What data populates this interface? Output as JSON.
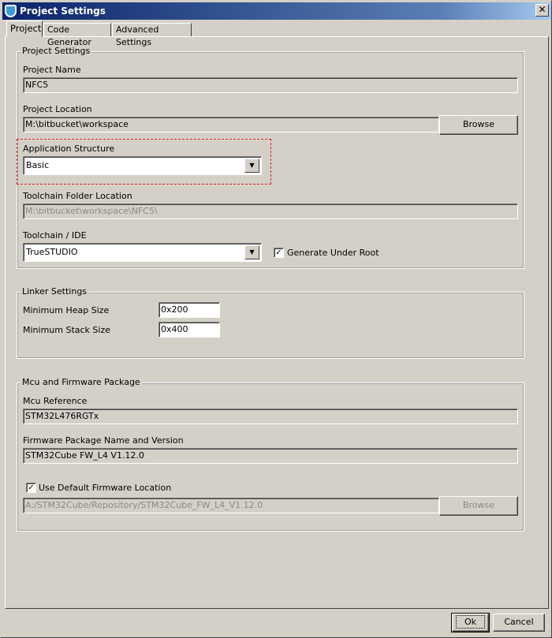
{
  "window": {
    "title": "Project Settings",
    "close": "✕"
  },
  "tabs": [
    {
      "label": "Project"
    },
    {
      "label": "Code Generator"
    },
    {
      "label": "Advanced Settings"
    }
  ],
  "project_settings": {
    "legend": "Project Settings",
    "name_label": "Project Name",
    "name_value": "NFC5",
    "location_label": "Project Location",
    "location_value": "M:\\bitbucket\\workspace",
    "browse": "Browse",
    "structure_label": "Application Structure",
    "structure_value": "Basic",
    "toolchain_folder_label": "Toolchain Folder Location",
    "toolchain_folder_value": "M:\\bitbucket\\workspace\\NFC5\\",
    "toolchain_label": "Toolchain / IDE",
    "toolchain_value": "TrueSTUDIO",
    "generate_under_root": "Generate Under Root",
    "generate_under_root_checked": true
  },
  "linker": {
    "legend": "Linker Settings",
    "heap_label": "Minimum Heap Size",
    "heap_value": "0x200",
    "stack_label": "Minimum Stack Size",
    "stack_value": "0x400"
  },
  "mcu": {
    "legend": "Mcu and Firmware Package",
    "ref_label": "Mcu Reference",
    "ref_value": "STM32L476RGTx",
    "fw_label": "Firmware Package Name and Version",
    "fw_value": "STM32Cube FW_L4 V1.12.0",
    "use_default": "Use Default Firmware Location",
    "use_default_checked": true,
    "fw_location": "A:/STM32Cube/Repository/STM32Cube_FW_L4_V1.12.0",
    "browse": "Browse"
  },
  "footer": {
    "ok": "Ok",
    "cancel": "Cancel"
  },
  "highlight_color": "#e02020"
}
